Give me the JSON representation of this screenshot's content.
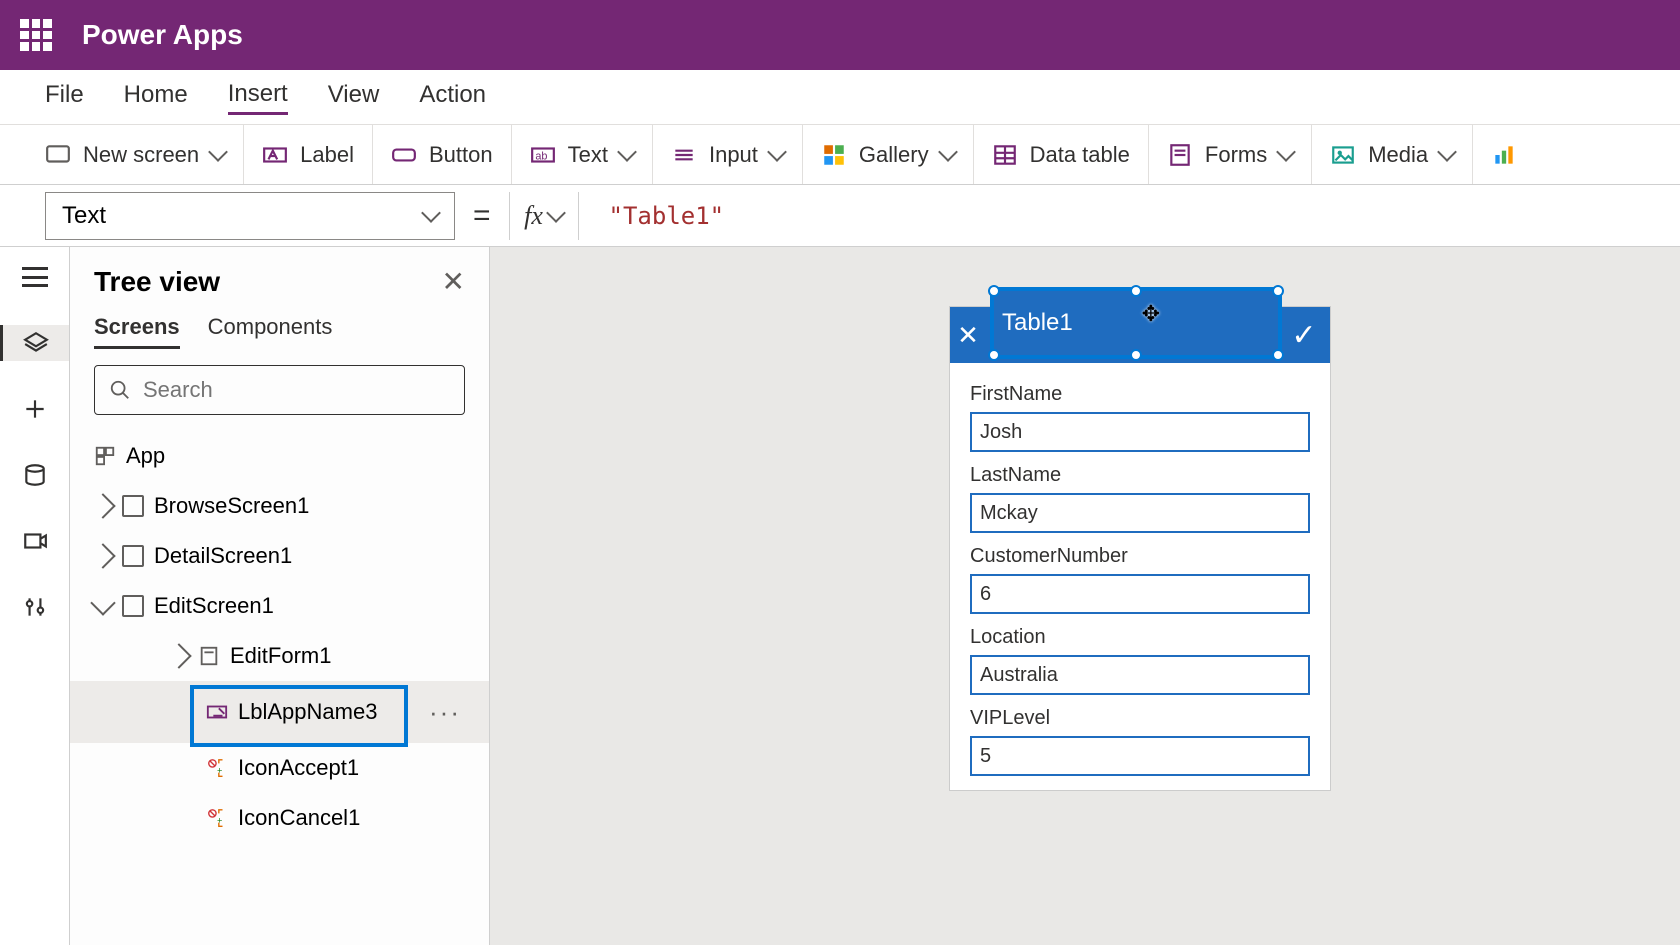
{
  "header": {
    "app_name": "Power Apps"
  },
  "ribbon_tabs": {
    "file": "File",
    "home": "Home",
    "insert": "Insert",
    "view": "View",
    "action": "Action",
    "active": "insert"
  },
  "ribbon": {
    "new_screen": "New screen",
    "label": "Label",
    "button": "Button",
    "text": "Text",
    "input": "Input",
    "gallery": "Gallery",
    "data_table": "Data table",
    "forms": "Forms",
    "media": "Media"
  },
  "formula_bar": {
    "property": "Text",
    "equals": "=",
    "fx": "fx",
    "value": "\"Table1\""
  },
  "tree": {
    "title": "Tree view",
    "tabs": {
      "screens": "Screens",
      "components": "Components",
      "active": "screens"
    },
    "search_placeholder": "Search",
    "items": {
      "app": "App",
      "browse": "BrowseScreen1",
      "detail": "DetailScreen1",
      "edit": "EditScreen1",
      "editform": "EditForm1",
      "lblapp": "LblAppName3",
      "iconaccept": "IconAccept1",
      "iconcancel": "IconCancel1"
    }
  },
  "form": {
    "title_text": "Table1",
    "fields": [
      {
        "label": "FirstName",
        "value": "Josh"
      },
      {
        "label": "LastName",
        "value": "Mckay"
      },
      {
        "label": "CustomerNumber",
        "value": "6"
      },
      {
        "label": "Location",
        "value": "Australia"
      },
      {
        "label": "VIPLevel",
        "value": "5"
      }
    ]
  }
}
